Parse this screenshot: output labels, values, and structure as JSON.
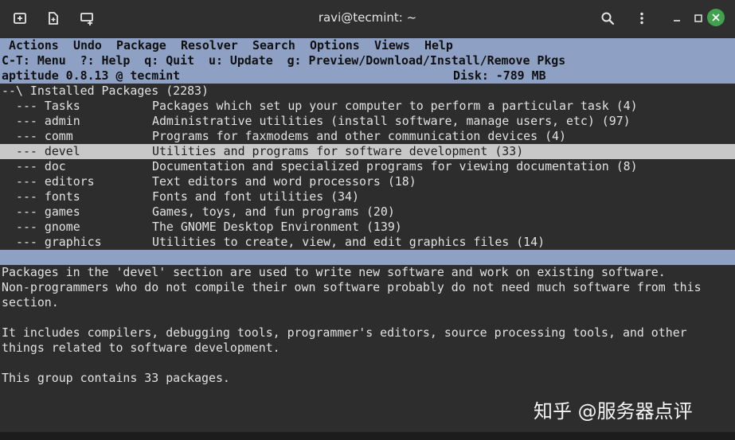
{
  "window": {
    "title": "ravi@tecmint: ~"
  },
  "titlebar": {
    "icons": [
      "new-tab-icon",
      "open-file-icon",
      "split-terminal-icon",
      "search-icon",
      "kebab-menu-icon",
      "minimize-icon",
      "maximize-icon",
      "close-icon"
    ],
    "close_color": "#3fa34d"
  },
  "menu": {
    "items": [
      "Actions",
      "Undo",
      "Package",
      "Resolver",
      "Search",
      "Options",
      "Views",
      "Help"
    ]
  },
  "shortcuts": "C-T: Menu  ?: Help  q: Quit  u: Update  g: Preview/Download/Install/Remove Pkgs",
  "status": {
    "version": "aptitude 0.8.13 @ tecmint",
    "disk": "Disk: -789 MB"
  },
  "tree": {
    "root": "--\\ Installed Packages (2283)",
    "sections": [
      {
        "name": "--- Tasks",
        "desc": "Packages which set up your computer to perform a particular task (4)"
      },
      {
        "name": "--- admin",
        "desc": "Administrative utilities (install software, manage users, etc) (97)"
      },
      {
        "name": "--- comm",
        "desc": "Programs for faxmodems and other communication devices (4)"
      },
      {
        "name": "--- devel",
        "desc": "Utilities and programs for software development (33)",
        "selected": true
      },
      {
        "name": "--- doc",
        "desc": "Documentation and specialized programs for viewing documentation (8)"
      },
      {
        "name": "--- editors",
        "desc": "Text editors and word processors (18)"
      },
      {
        "name": "--- fonts",
        "desc": "Fonts and font utilities (34)"
      },
      {
        "name": "--- games",
        "desc": "Games, toys, and fun programs (20)"
      },
      {
        "name": "--- gnome",
        "desc": "The GNOME Desktop Environment (139)"
      },
      {
        "name": "--- graphics",
        "desc": "Utilities to create, view, and edit graphics files (14)"
      }
    ]
  },
  "description": {
    "lines": [
      "Packages in the 'devel' section are used to write new software and work on existing software.",
      "Non-programmers who do not compile their own software probably do not need much software from this",
      "section.",
      "",
      "It includes compilers, debugging tools, programmer's editors, source processing tools, and other",
      "things related to software development.",
      "",
      "This group contains 33 packages."
    ]
  },
  "watermark": "知乎 @服务器点评",
  "colors": {
    "header_bg": "#8ea1c4",
    "selected_bg": "#c8c8c8",
    "terminal_bg": "#2d2d2d",
    "titlebar_bg": "#2f2f2f"
  }
}
